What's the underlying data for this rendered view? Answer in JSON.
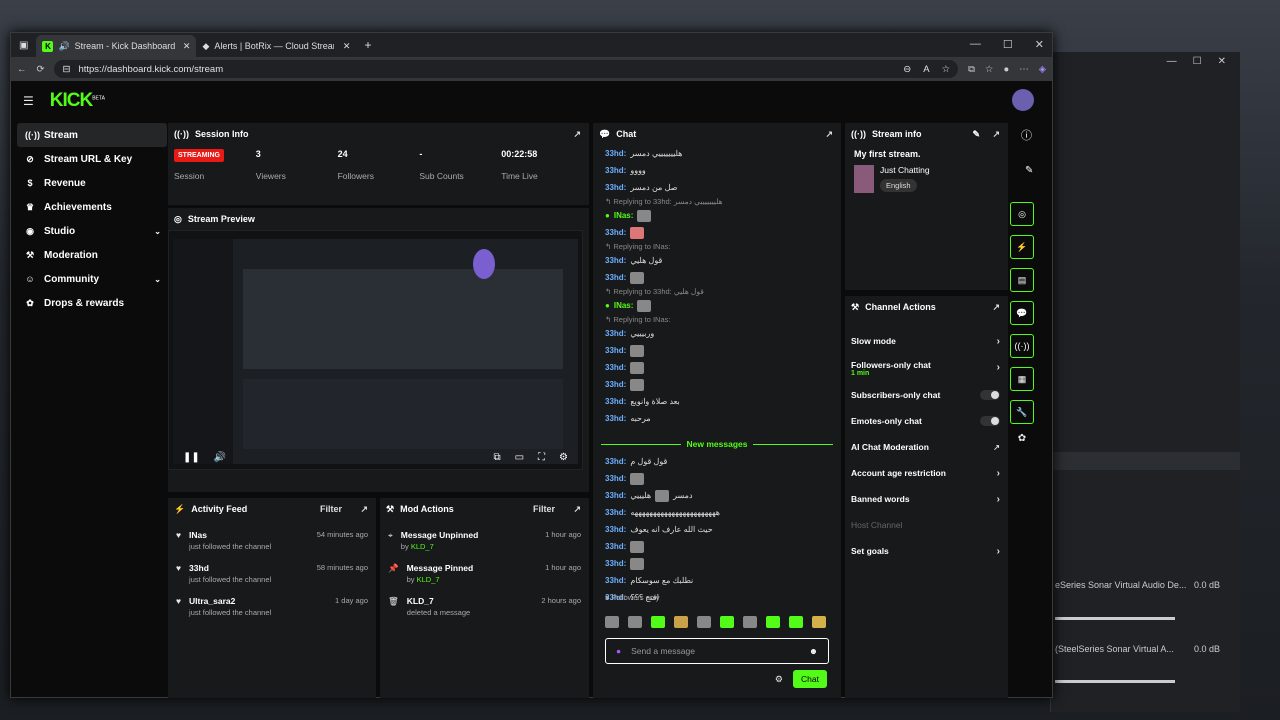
{
  "tabs": [
    {
      "label": "Stream - Kick Dashboard"
    },
    {
      "label": "Alerts | BotRix — Cloud Streamin"
    }
  ],
  "url": "https://dashboard.kick.com/stream",
  "brand": {
    "logo": "KICK",
    "beta": "BETA",
    "accent": "#53fc18"
  },
  "sidebar": {
    "items": [
      {
        "label": "Stream",
        "icon": "broadcast-icon"
      },
      {
        "label": "Stream URL & Key",
        "icon": "link-icon"
      },
      {
        "label": "Revenue",
        "icon": "dollar-icon"
      },
      {
        "label": "Achievements",
        "icon": "trophy-icon"
      },
      {
        "label": "Studio",
        "icon": "camera-icon"
      },
      {
        "label": "Moderation",
        "icon": "hammer-icon"
      },
      {
        "label": "Community",
        "icon": "users-icon"
      },
      {
        "label": "Drops & rewards",
        "icon": "gift-icon"
      }
    ]
  },
  "session": {
    "title": "Session Info",
    "status": "STREAMING",
    "status_label": "Session",
    "viewers": "3",
    "viewers_label": "Viewers",
    "followers": "24",
    "followers_label": "Followers",
    "subs": "-",
    "subs_label": "Sub Counts",
    "time": "00:22:58",
    "time_label": "Time Live"
  },
  "preview": {
    "title": "Stream Preview"
  },
  "activity": {
    "title": "Activity Feed",
    "filter": "Filter",
    "items": [
      {
        "name": "INas",
        "desc": "just followed the channel",
        "time": "54 minutes ago"
      },
      {
        "name": "33hd",
        "desc": "just followed the channel",
        "time": "58 minutes ago"
      },
      {
        "name": "Ultra_sara2",
        "desc": "just followed the channel",
        "time": "1 day ago"
      }
    ]
  },
  "mod": {
    "title": "Mod Actions",
    "filter": "Filter",
    "items": [
      {
        "action": "Message Unpinned",
        "by": "by",
        "user": "KLD_7",
        "time": "1 hour ago"
      },
      {
        "action": "Message Pinned",
        "by": "by",
        "user": "KLD_7",
        "time": "1 hour ago"
      },
      {
        "action": "KLD_7",
        "by": "deleted a message",
        "user": "",
        "time": "2 hours ago"
      }
    ]
  },
  "chat": {
    "title": "Chat",
    "new_messages": "New messages",
    "followers_only": "Followers only",
    "placeholder": "Send a message",
    "send": "Chat"
  },
  "stream_info": {
    "title": "Stream info",
    "stream_title": "My first stream.",
    "category": "Just Chatting",
    "language": "English"
  },
  "channel_actions": {
    "title": "Channel Actions",
    "slow_mode": "Slow mode",
    "followers_only": "Followers-only chat",
    "followers_min": "1 min",
    "subscribers_only": "Subscribers-only chat",
    "emotes_only": "Emotes-only chat",
    "ai_moderation": "AI Chat Moderation",
    "account_age": "Account age restriction",
    "banned_words": "Banned words",
    "host_channel": "Host Channel",
    "set_goals": "Set goals"
  },
  "bg_app": {
    "audio1": "eSeries Sonar Virtual Audio De...",
    "audio1_db": "0.0 dB",
    "audio2": "(SteelSeries Sonar Virtual A...",
    "audio2_db": "0.0 dB"
  }
}
